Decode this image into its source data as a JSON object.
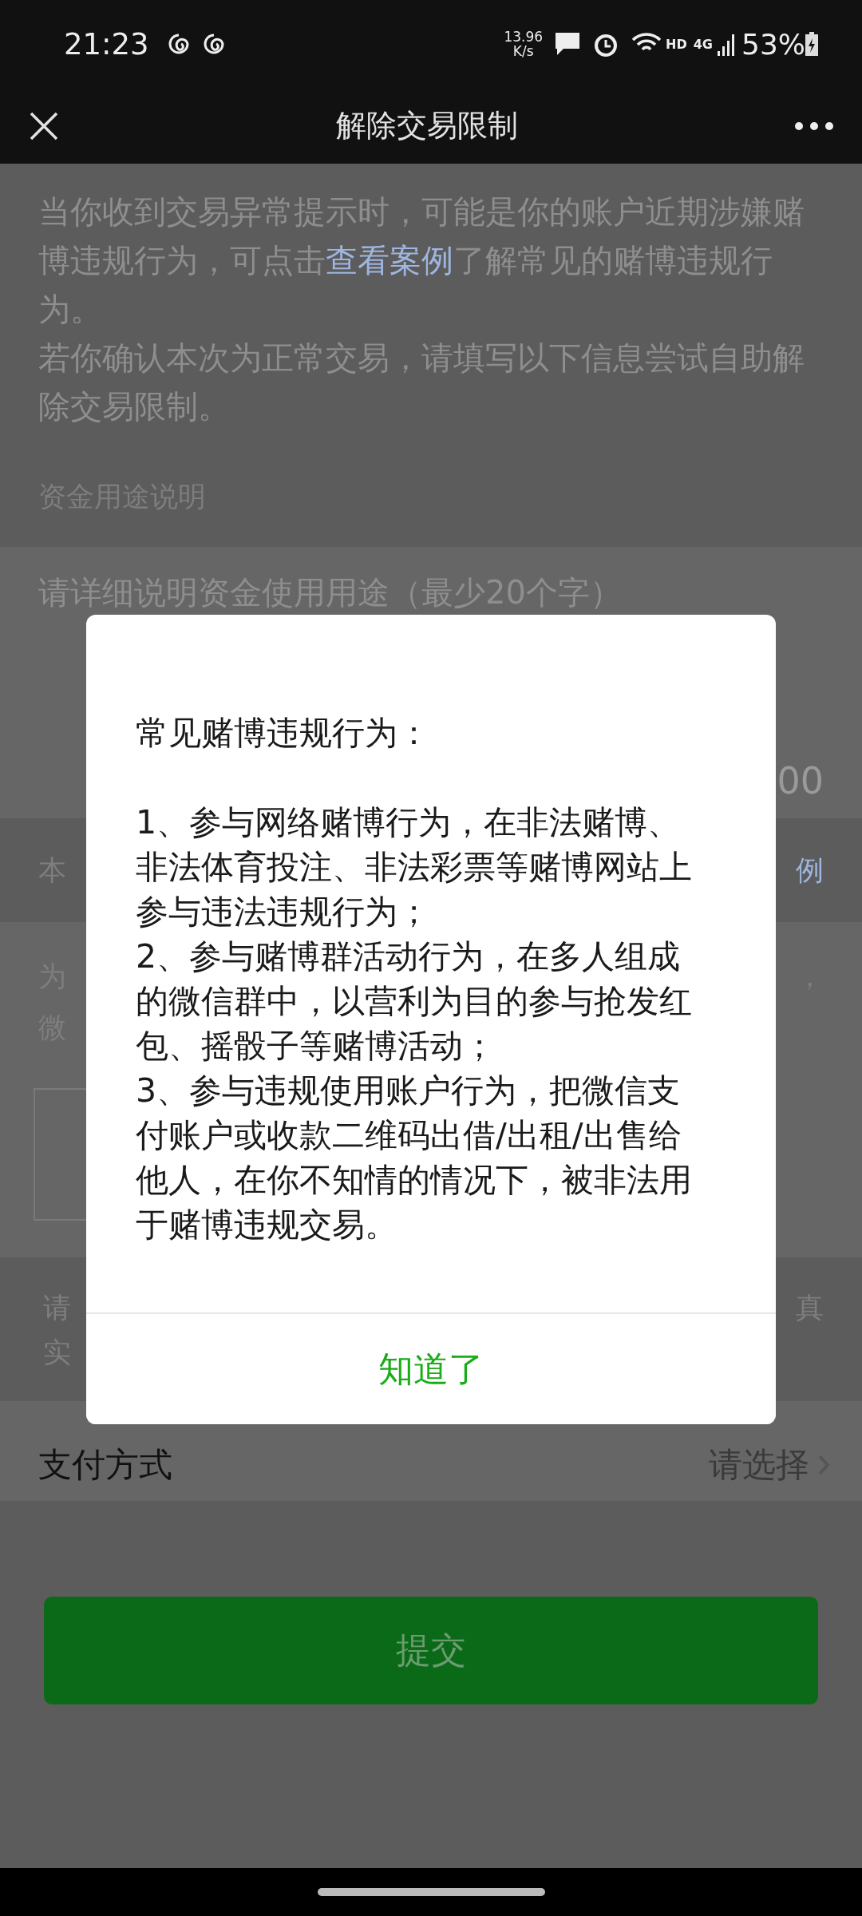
{
  "status_bar": {
    "time": "21:23",
    "speed": "13.96",
    "speed_unit": "K/s",
    "hd": "HD",
    "network": "4G",
    "battery": "53%"
  },
  "nav": {
    "title": "解除交易限制"
  },
  "notice": {
    "before": "当你收到交易异常提示时，可能是你的账户近期涉嫌赌博违规行为，可点击",
    "link": "查看案例",
    "after": "了解常见的赌博违规行为。",
    "second": "若你确认本次为正常交易，请填写以下信息尝试自助解除交易限制。"
  },
  "purpose": {
    "label": "资金用途说明",
    "placeholder": "请详细说明资金使用用途（最少20个字）",
    "counter": "00"
  },
  "identity": {
    "label": "本",
    "link": "例",
    "line_1": "为",
    "line_1_end": "，",
    "line_2": "微"
  },
  "hint": {
    "line_1": "请",
    "line_1_end": "真",
    "line_2": "实"
  },
  "payment": {
    "label": "支付方式",
    "value": "请选择"
  },
  "submit": {
    "label": "提交"
  },
  "dialog": {
    "title": "常见赌博违规行为：",
    "items": [
      "1、参与网络赌博行为，在非法赌博、非法体育投注、非法彩票等赌博网站上参与违法违规行为；",
      "2、参与赌博群活动行为，在多人组成的微信群中，以营利为目的参与抢发红包、摇骰子等赌博活动；",
      "3、参与违规使用账户行为，把微信支付账户或收款二维码出借/出租/出售给他人，在你不知情的情况下，被非法用于赌博违规交易。"
    ],
    "confirm": "知道了"
  }
}
